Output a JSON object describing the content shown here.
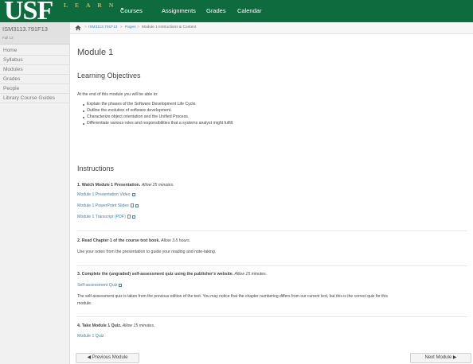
{
  "brand": {
    "logo": "USF",
    "subtitle": "LEARN"
  },
  "topnav": {
    "courses": "Courses",
    "assignments": "Assignments",
    "grades": "Grades",
    "calendar": "Calendar"
  },
  "course": {
    "code": "ISM3113.791F13",
    "term": "Fall 13"
  },
  "sidebar": {
    "items": [
      {
        "label": "Home"
      },
      {
        "label": "Syllabus"
      },
      {
        "label": "Modules"
      },
      {
        "label": "Grades"
      },
      {
        "label": "People"
      },
      {
        "label": "Library Course Guides"
      }
    ]
  },
  "breadcrumb": {
    "course": "ISM3113.791F13",
    "sep": ">",
    "pages": "Pages",
    "current": "Module 1 Instructions & Content"
  },
  "page": {
    "title": "Module 1",
    "objectives_heading": "Learning Objectives",
    "objectives_intro": "At the end of this module you will be able to:",
    "objectives": [
      "Explain the phases of the Software Development Life Cycle.",
      "Outline the evolution of software development.",
      "Characterize object orientation and the Unified Process.",
      "Differentiate various roles and responsibilities that a systems analyst might fulfill."
    ],
    "instructions_heading": "Instructions",
    "step1": {
      "title": "1. Watch Module 1 Presentation.",
      "time": "Allow 25 minutes.",
      "links": [
        "Module 1 Presentation Video",
        "Module 1 PowerPoint Slides",
        "Module 1 Transcript (PDF)"
      ]
    },
    "step2": {
      "title": "2. Read Chapter 1 of the course text book.",
      "time": "Allow 3.5 hours.",
      "text": "Use your notes from the presentation to guide your reading and note-taking."
    },
    "step3": {
      "title": "3. Complete the (ungraded) self-assessment quiz using the publisher's website.",
      "time": "Allow 15 minutes.",
      "link": "Self-assessment Quiz",
      "text1": "The self-assessment quiz is taken from the previous edition of the text. You may notice that the chapter numbering differs from our current text, but this is the correct quiz for this",
      "text2": "module."
    },
    "step4": {
      "title": "4. Take Module 1 Quiz.",
      "time": "Allow 15 minutes.",
      "link": "Module 1 Quiz"
    }
  },
  "footer": {
    "prev": "Previous Module",
    "next": "Next Module"
  }
}
